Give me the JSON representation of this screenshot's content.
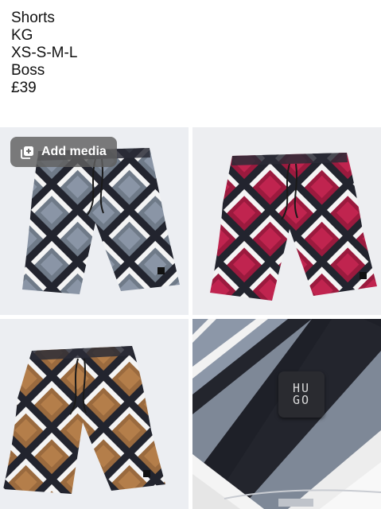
{
  "caption": {
    "lines": [
      "Shorts",
      "KG",
      "XS-S-M-L",
      "Boss",
      "£39"
    ]
  },
  "toolbar": {
    "add_media_label": "Add media",
    "add_media_icon": "add-media-icon",
    "layout_icon": "layout-icon",
    "edit_icon": "pencil-icon"
  },
  "photos": [
    {
      "name": "grey shorts",
      "accent": "#6f7a88"
    },
    {
      "name": "burgundy shorts",
      "accent": "#9b1a3e"
    },
    {
      "name": "brown shorts",
      "accent": "#9a6a3e"
    },
    {
      "name": "close-up logo",
      "accent": "#8a95a6"
    }
  ],
  "logo_text": {
    "line1": "HU",
    "line2": "GO"
  }
}
